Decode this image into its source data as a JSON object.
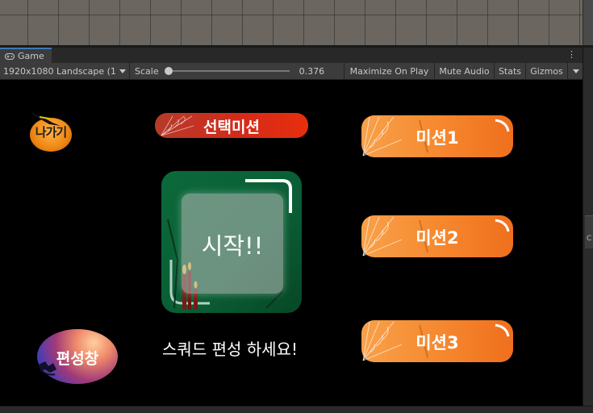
{
  "editor": {
    "game_tab": "Game",
    "menu_icon": "⋮",
    "resolution": "1920x1080 Landscape (1",
    "scale_label": "Scale",
    "scale_value": "0.376",
    "maximize_label": "Maximize On Play",
    "mute_label": "Mute Audio",
    "stats_label": "Stats",
    "gizmos_label": "Gizmos",
    "right_panel_letter": "C"
  },
  "game": {
    "exit_label": "나가기",
    "select_mission_label": "선택미션",
    "start_label": "시작!!",
    "squad_message": "스쿼드 편성 하세요!",
    "edit_label": "편성창",
    "missions": [
      {
        "label": "미션1"
      },
      {
        "label": "미션2"
      },
      {
        "label": "미션3"
      }
    ]
  },
  "colors": {
    "accent_tab": "#3a79bb",
    "mission_orange": "#f6892f",
    "select_red": "#d52a1a",
    "start_green": "#0b6a3a"
  }
}
